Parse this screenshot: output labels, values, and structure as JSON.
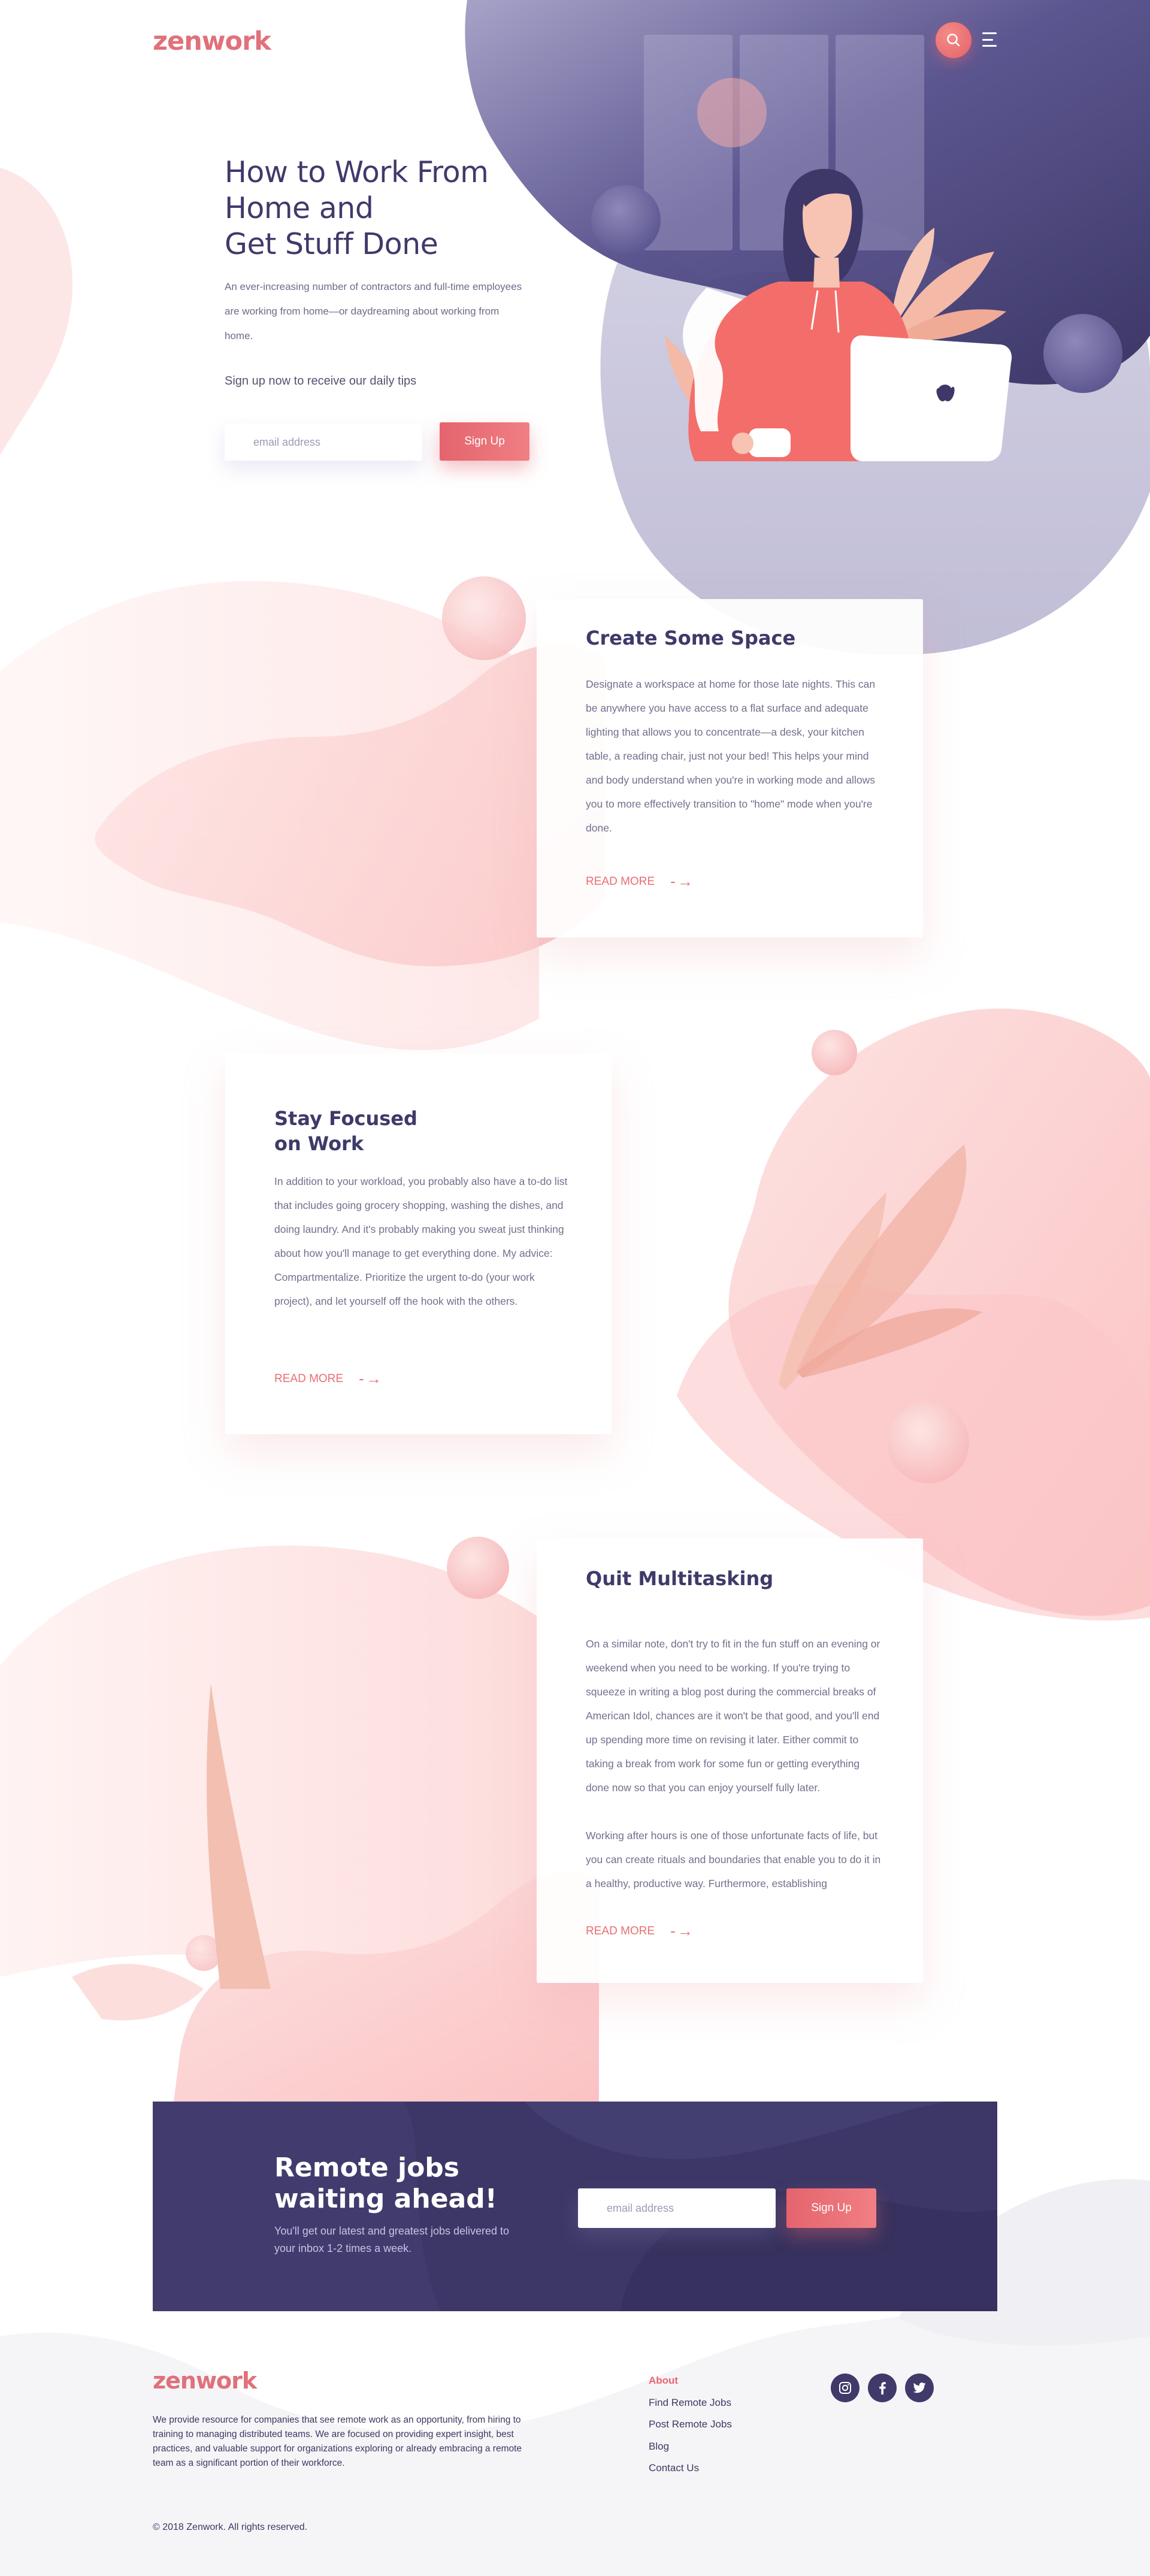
{
  "brand": {
    "logo_text": "zenwork",
    "colors": {
      "accent": "#e4646e",
      "navy": "#3c3766",
      "text": "#3b3860",
      "blob_pink": "#fcc9c9"
    }
  },
  "header": {
    "search_icon": "search-icon",
    "menu_icon": "hamburger-menu-icon"
  },
  "hero": {
    "title": "How to Work From\nHome and\nGet Stuff Done",
    "description": "An ever-increasing number of contractors and full-time employees are working from home—or daydreaming about working from home.",
    "cta_text": "Sign up now to receive our daily tips",
    "email_placeholder": "email address",
    "signup_label": "Sign Up"
  },
  "features": [
    {
      "title": "Create Some Space",
      "body": "Designate a workspace at home for those late nights. This can be anywhere you have access to a flat surface and adequate lighting that allows you to concentrate—a desk, your kitchen table, a reading chair, just not your bed! This helps your mind and body understand when you're in working mode and allows you to more effectively transition to \"home\" mode when you're done.",
      "read_more": "READ MORE"
    },
    {
      "title": "Stay Focused\non Work",
      "body": "In addition to your workload, you probably also have a to-do list that includes going grocery shopping, washing the dishes, and doing laundry. And it's probably making you sweat just thinking about how you'll manage to get everything done. My advice: Compartmentalize. Prioritize the urgent to-do (your work project), and let yourself off the hook with the others.",
      "read_more": "READ MORE"
    },
    {
      "title": "Quit Multitasking",
      "body": "On a similar note, don't try to fit in the fun stuff on an evening or weekend when you need to be working. If you're trying to squeeze in writing a blog post during the commercial breaks of American Idol, chances are it won't be that good, and you'll end up spending more time on revising it later. Either commit to taking a break from work for some fun or getting everything done now so that you can enjoy yourself fully later.",
      "body_2": "Working after hours is one of those unfortunate facts of life, but you can create rituals and boundaries that enable you to do it in a healthy, productive way. Furthermore, establishing",
      "read_more": "READ MORE"
    }
  ],
  "newsletter": {
    "title": "Remote jobs\nwaiting ahead!",
    "description": "You'll get our latest and greatest jobs delivered to your inbox 1-2 times a week.",
    "email_placeholder": "email address",
    "signup_label": "Sign Up"
  },
  "footer": {
    "logo_text": "zenwork",
    "description": "We provide resource for companies that see remote work as an opportunity, from hiring to training to managing distributed teams.  We are focused on providing expert insight, best practices, and valuable support for organizations exploring or already embracing a remote team as a significant portion of their workforce.",
    "links": [
      "About",
      "Find Remote Jobs",
      "Post Remote Jobs",
      "Blog",
      "Contact Us"
    ],
    "social_icons": [
      "instagram-icon",
      "facebook-icon",
      "twitter-icon"
    ],
    "copyright": "© 2018 Zenwork. All rights reserved."
  }
}
